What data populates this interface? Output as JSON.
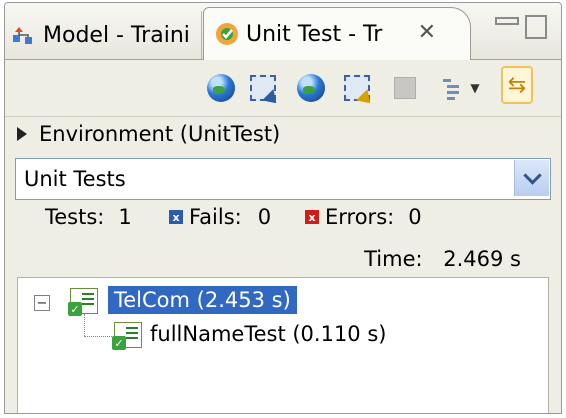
{
  "tabs": [
    {
      "label": "Model - Traini",
      "icon": "model-icon"
    },
    {
      "label": "Unit Test - Tr",
      "icon": "unit-test-icon"
    }
  ],
  "toolbar_icons": [
    "run-globe-icon",
    "select-icon",
    "run-selected-globe-icon",
    "select-edit-icon",
    "stop-icon",
    "tree-view-icon",
    "dropdown-icon",
    "sync-icon"
  ],
  "environment": {
    "label": "Environment (UnitTest)"
  },
  "suite_combo": {
    "value": "Unit Tests"
  },
  "stats": {
    "tests_label": "Tests:",
    "tests_value": "1",
    "fails_label": "Fails:",
    "fails_value": "0",
    "errors_label": "Errors:",
    "errors_value": "0",
    "time_label": "Time:",
    "time_value": "2.469 s"
  },
  "tree": {
    "root": {
      "label": "TelCom (2.453 s)",
      "expanded": true,
      "selected": true,
      "status": "pass"
    },
    "children": [
      {
        "label": "fullNameTest (0.110 s)",
        "status": "pass"
      }
    ]
  },
  "colors": {
    "selection": "#3168c2",
    "pass": "#3ba33b",
    "fail": "#2d5bb0",
    "error": "#d21b1b"
  }
}
